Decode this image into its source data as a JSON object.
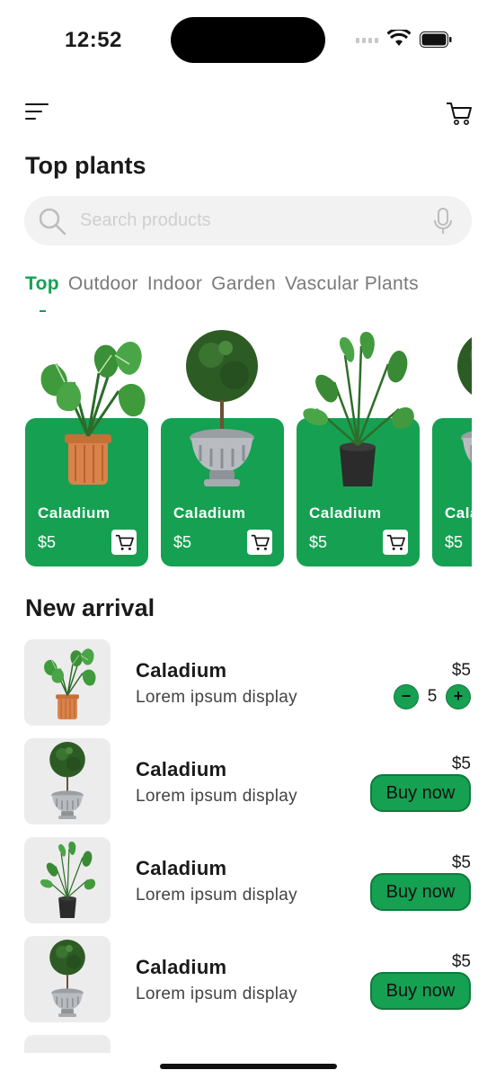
{
  "status_bar": {
    "time": "12:52"
  },
  "header": {
    "title": "Top plants"
  },
  "search": {
    "placeholder": "Search products"
  },
  "tabs": [
    {
      "label": "Top",
      "active": true
    },
    {
      "label": "Outdoor",
      "active": false
    },
    {
      "label": "Indoor",
      "active": false
    },
    {
      "label": "Garden",
      "active": false
    },
    {
      "label": "Vascular Plants",
      "active": false
    }
  ],
  "top_plants": [
    {
      "name": "Caladium",
      "price": "$5",
      "image": "caladium-plant-icon"
    },
    {
      "name": "Caladium",
      "price": "$5",
      "image": "topiary-plant-icon"
    },
    {
      "name": "Caladium",
      "price": "$5",
      "image": "palm-plant-icon"
    },
    {
      "name": "Caladium",
      "price": "$5",
      "image": "topiary-plant-icon"
    }
  ],
  "new_arrival": {
    "title": "New arrival",
    "items": [
      {
        "name": "Caladium",
        "desc": "Lorem ipsum display",
        "price": "$5",
        "quantity": "5",
        "image": "caladium-plant-icon"
      },
      {
        "name": "Caladium",
        "desc": "Lorem ipsum display",
        "price": "$5",
        "button": "Buy now",
        "image": "topiary-plant-icon"
      },
      {
        "name": "Caladium",
        "desc": "Lorem ipsum display",
        "price": "$5",
        "button": "Buy now",
        "image": "palm-plant-icon"
      },
      {
        "name": "Caladium",
        "desc": "Lorem ipsum display",
        "price": "$5",
        "button": "Buy now",
        "image": "topiary-plant-icon"
      }
    ]
  },
  "colors": {
    "accent": "#16a052",
    "accent_dark": "#0f7a3d",
    "search_bg": "#f2f2f2",
    "thumb_bg": "#ececec"
  },
  "stepper": {
    "minus": "−",
    "plus": "+"
  }
}
